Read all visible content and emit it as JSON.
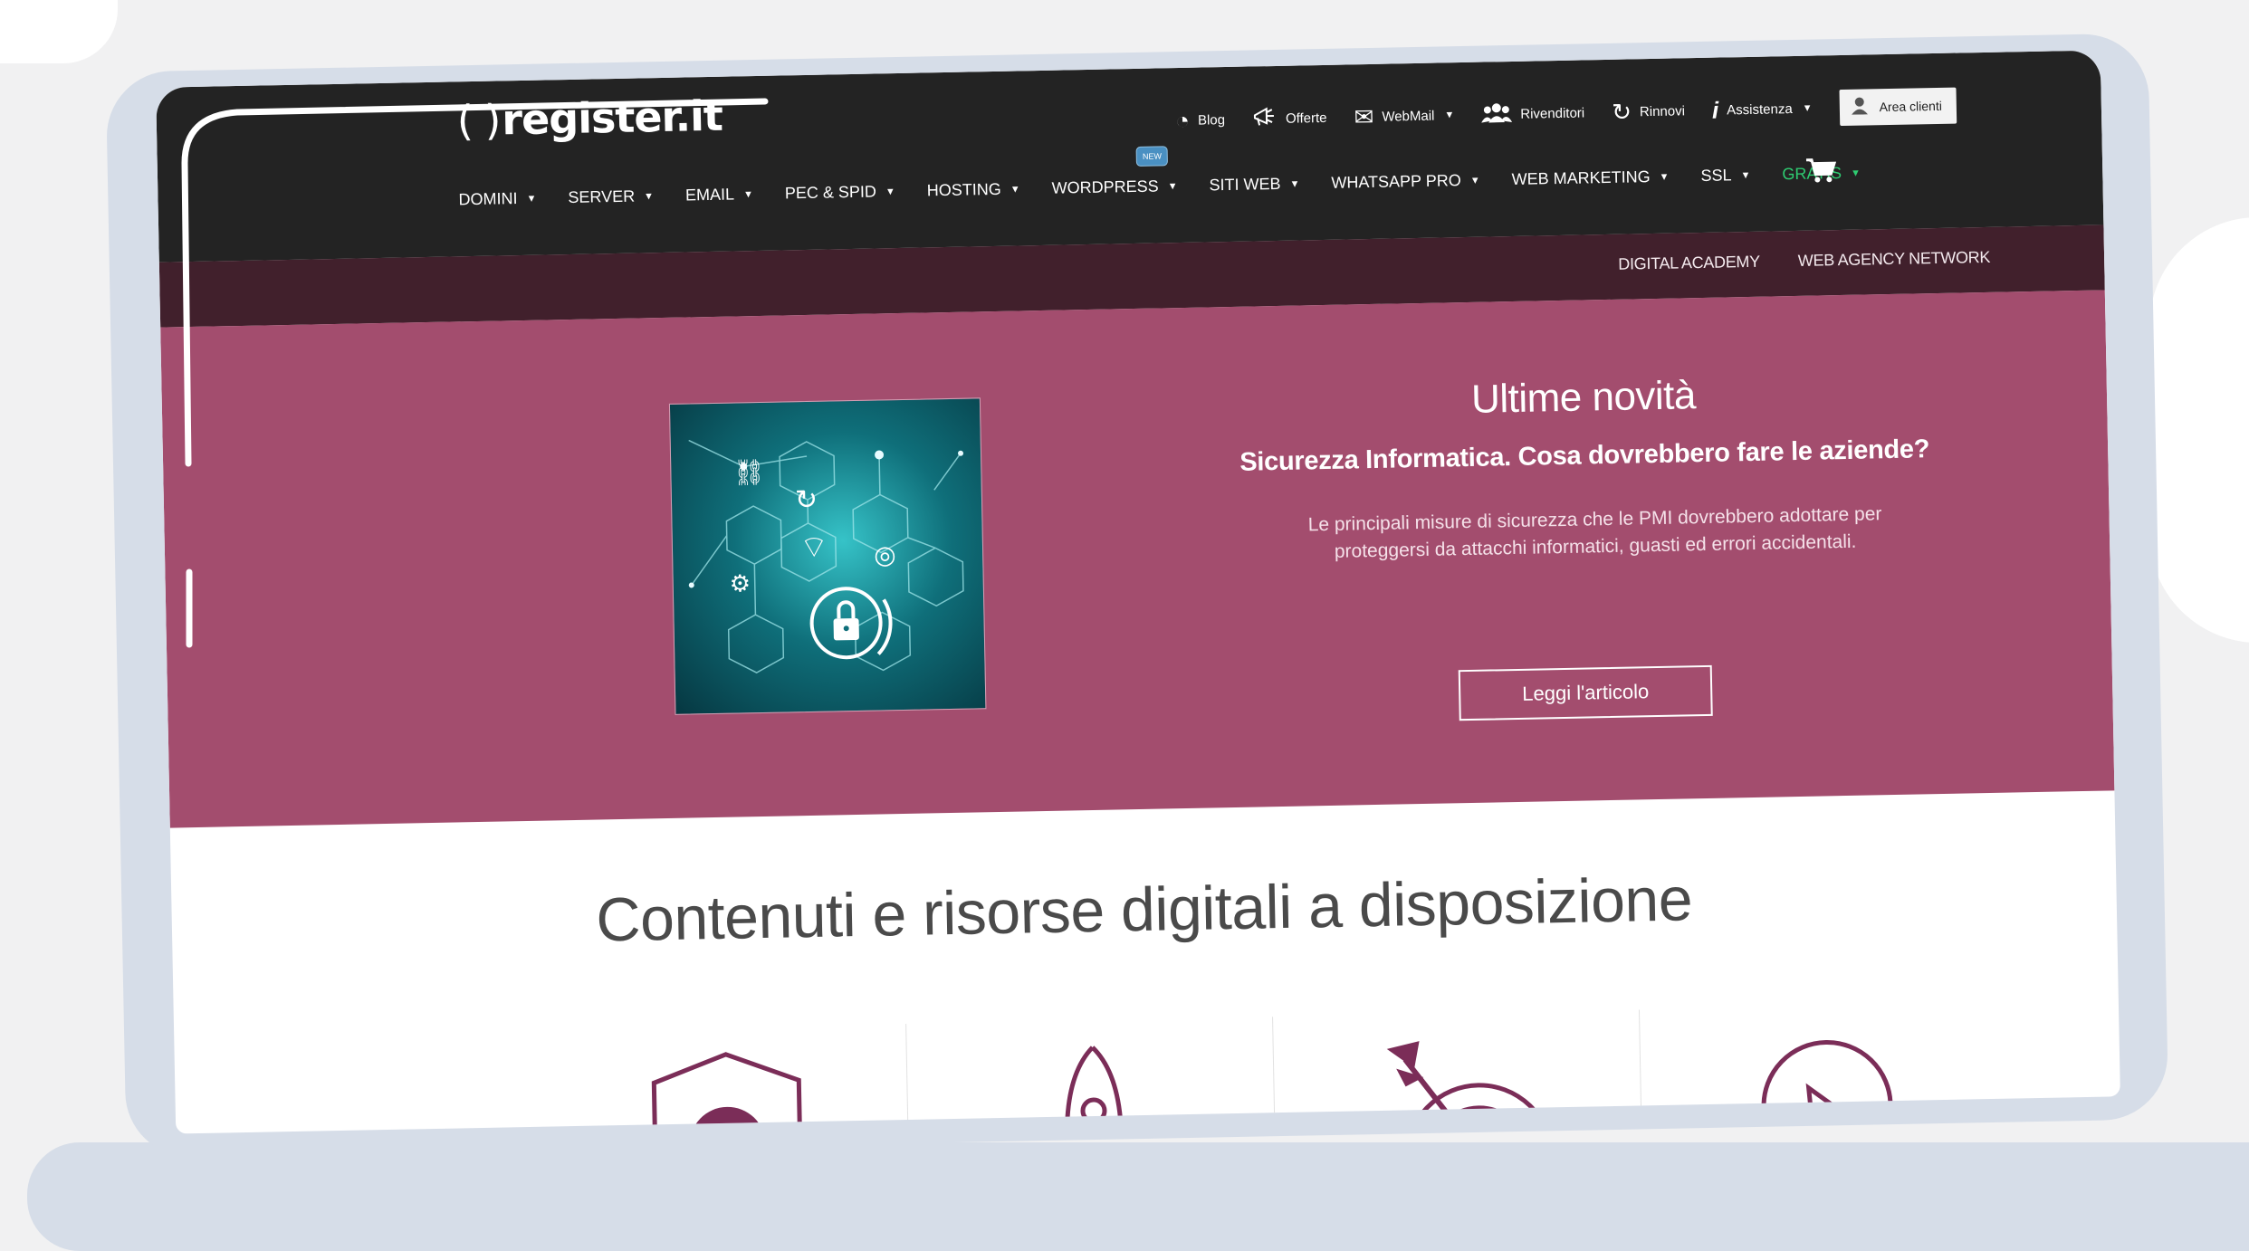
{
  "brand": {
    "logo_text": "register.it",
    "logo_brackets": "( )"
  },
  "utility_nav": [
    {
      "label": "Blog",
      "icon": "blog-icon",
      "glyph": "◔",
      "caret": false
    },
    {
      "label": "Offerte",
      "icon": "megaphone-icon",
      "glyph": "📣",
      "caret": false
    },
    {
      "label": "WebMail",
      "icon": "mail-icon",
      "glyph": "✉",
      "caret": true
    },
    {
      "label": "Rivenditori",
      "icon": "users-icon",
      "glyph": "👥",
      "caret": false
    },
    {
      "label": "Rinnovi",
      "icon": "refresh-icon",
      "glyph": "↻",
      "caret": false
    },
    {
      "label": "Assistenza",
      "icon": "info-icon",
      "glyph": "ℹ",
      "caret": true
    }
  ],
  "area_clienti": {
    "label": "Area clienti",
    "icon": "user-icon"
  },
  "main_nav": [
    {
      "label": "DOMINI"
    },
    {
      "label": "SERVER"
    },
    {
      "label": "EMAIL"
    },
    {
      "label": "PEC & SPID"
    },
    {
      "label": "HOSTING"
    },
    {
      "label": "WORDPRESS",
      "badge": "NEW"
    },
    {
      "label": "SITI WEB"
    },
    {
      "label": "WHATSAPP PRO"
    },
    {
      "label": "WEB MARKETING"
    },
    {
      "label": "SSL"
    },
    {
      "label": "GRATIS",
      "highlight": true
    }
  ],
  "cart": {
    "icon": "cart-icon"
  },
  "sub_nav": [
    "DIGITAL ACADEMY",
    "WEB AGENCY NETWORK"
  ],
  "hero": {
    "title": "Ultime novità",
    "subtitle": "Sicurezza Informatica. Cosa dovrebbero fare le aziende?",
    "description": "Le principali misure di sicurezza che le PMI dovrebbero adottare per proteggersi da attacchi informatici, guasti ed errori accidentali.",
    "button": "Leggi l'articolo",
    "image": "cybersecurity-illustration"
  },
  "resources": {
    "title": "Contenuti e risorse digitali a disposizione",
    "icons": [
      "shield-check-icon",
      "rocket-icon",
      "target-arrow-icon",
      "chat-bubble-icon"
    ]
  },
  "colors": {
    "topbar": "#232323",
    "subnav": "#41202c",
    "hero": "#a34d6e",
    "accent_icon": "#7b2d58",
    "gratis": "#2ecc71"
  }
}
